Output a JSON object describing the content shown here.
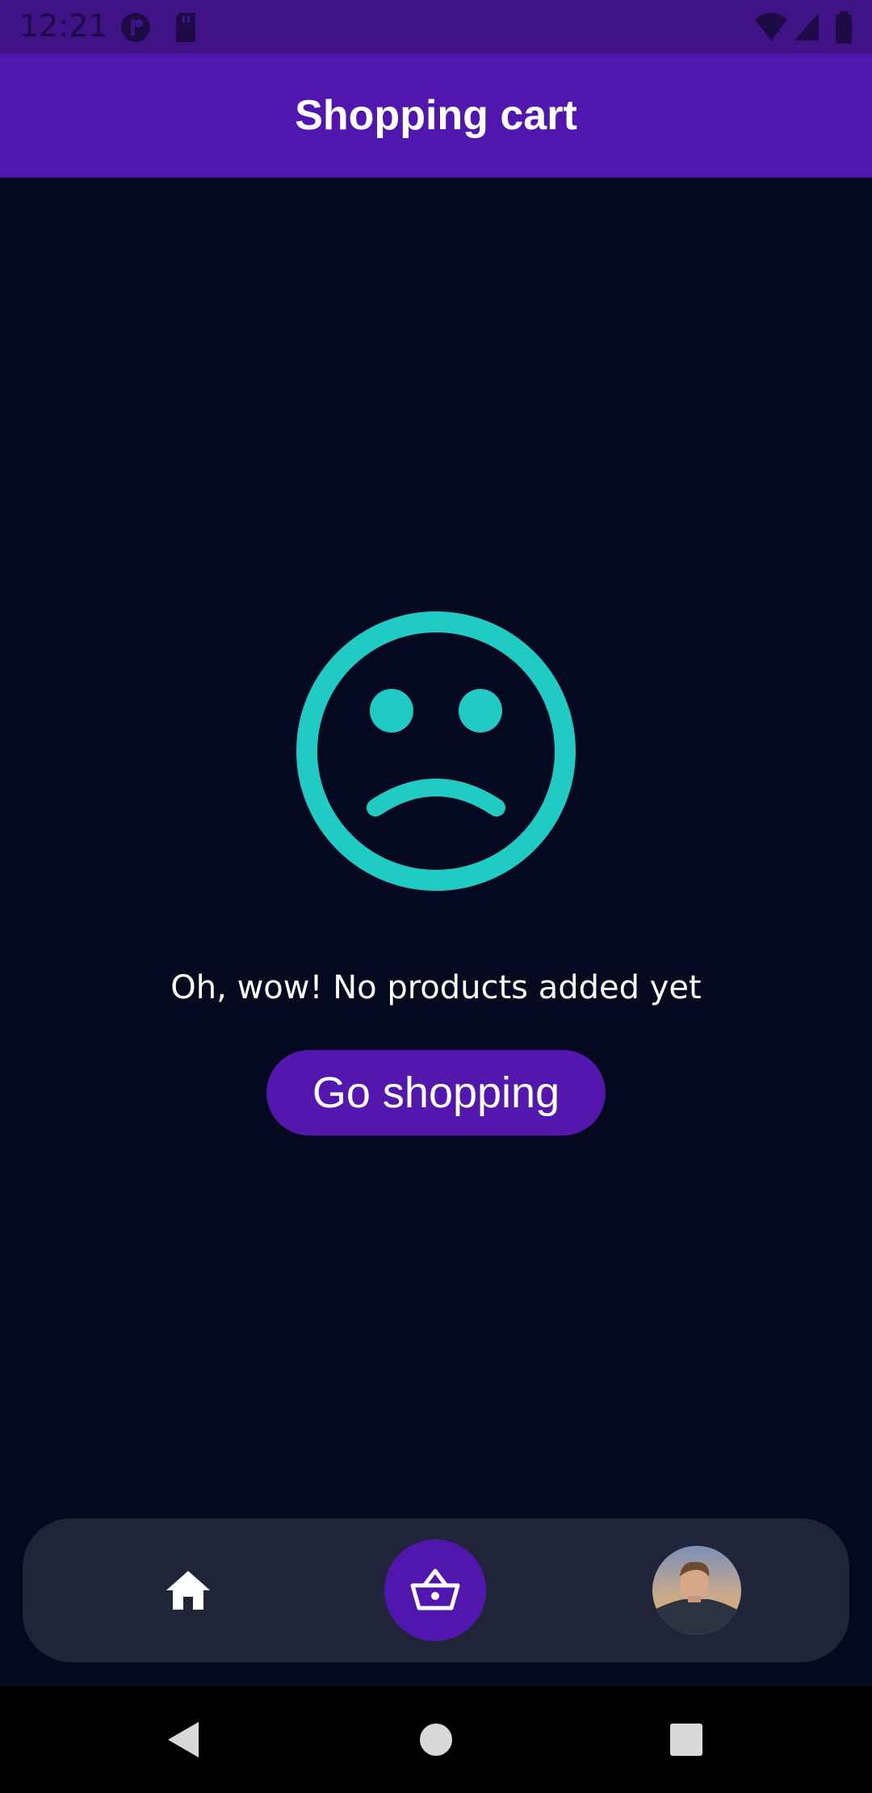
{
  "status_bar": {
    "time": "12:21"
  },
  "app_bar": {
    "title": "Shopping cart"
  },
  "empty_state": {
    "icon": "sad-face-icon",
    "message": "Oh, wow! No products added yet",
    "button_label": "Go shopping"
  },
  "bottom_nav": {
    "items": [
      {
        "icon": "home-icon",
        "active": false
      },
      {
        "icon": "basket-icon",
        "active": true
      },
      {
        "icon": "avatar",
        "active": false
      }
    ]
  },
  "colors": {
    "background": "#050920",
    "primary": "#5116ad",
    "accent": "#20cbc4",
    "nav_background": "#21253a"
  }
}
